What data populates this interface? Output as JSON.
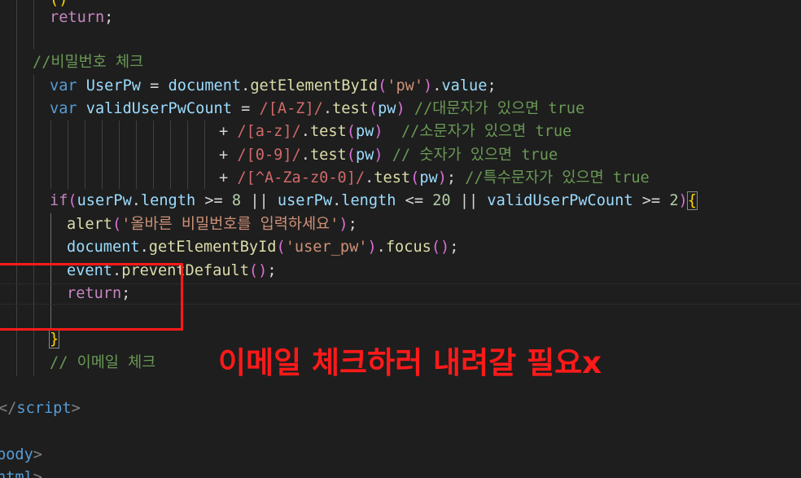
{
  "editor": {
    "language": "html",
    "theme": "dark",
    "colors": {
      "background": "#1e1e1e",
      "keyword": "#569cd6",
      "control": "#c586c0",
      "variable": "#9cdcfe",
      "function": "#dcdcaa",
      "string": "#ce9178",
      "regex": "#d16969",
      "comment": "#6a9955",
      "number": "#b5cea8",
      "annotation": "#ff1a1a"
    }
  },
  "code": {
    "l1": {
      "kw": "return",
      "p": ";"
    },
    "l3": {
      "comment": "//비밀번호 체크"
    },
    "l4": {
      "kw": "var",
      "name": "UserPw",
      "eq": " = ",
      "obj": "document",
      "dot": ".",
      "fn": "getElementById",
      "po": "(",
      "str": "'pw'",
      "pc": ")",
      "dot2": ".",
      "prop": "value",
      "semi": ";"
    },
    "l5": {
      "kw": "var",
      "name": "validUserPwCount",
      "eq": " = ",
      "re": "/[A-Z]/",
      "dot": ".",
      "fn": "test",
      "po": "(",
      "arg": "pw",
      "pc": ")",
      "sp": " ",
      "comment": "//대문자가 있으면 true"
    },
    "l6": {
      "plus": "+ ",
      "re": "/[a-z]/",
      "dot": ".",
      "fn": "test",
      "po": "(",
      "arg": "pw",
      "pc": ")",
      "sp": "  ",
      "comment": "//소문자가 있으면 true"
    },
    "l7": {
      "plus": "+ ",
      "re": "/[0-9]/",
      "dot": ".",
      "fn": "test",
      "po": "(",
      "arg": "pw",
      "pc": ")",
      "sp": " ",
      "comment": "// 숫자가 있으면 true"
    },
    "l8": {
      "plus": "+ ",
      "re": "/[^A-Za-z0-0]/",
      "dot": ".",
      "fn": "test",
      "po": "(",
      "arg": "pw",
      "pc": ")",
      "semi": "; ",
      "comment": "//특수문자가 있으면 true"
    },
    "l9": {
      "kw": "if",
      "po": "(",
      "v1": "userPw",
      "d1": ".",
      "p1": "length",
      "op1": " >= ",
      "n1": "8",
      "or1": " || ",
      "v2": "userPw",
      "d2": ".",
      "p2": "length",
      "op2": " <= ",
      "n2": "20",
      "or2": " || ",
      "v3": "validUserPwCount",
      "op3": " >= ",
      "n3": "2",
      "pc": ")",
      "bo": "{"
    },
    "l10": {
      "fn": "alert",
      "po": "(",
      "str": "'올바른 비밀번호를 입력하세요'",
      "pc": ")",
      "semi": ";"
    },
    "l11": {
      "obj": "document",
      "dot": ".",
      "fn": "getElementById",
      "po": "(",
      "str": "'user_pw'",
      "pc": ")",
      "dot2": ".",
      "fn2": "focus",
      "po2": "()",
      "semi": ";"
    },
    "l12": {
      "obj": "event",
      "dot": ".",
      "fn": "preventDefault",
      "po": "()",
      "semi": ";"
    },
    "l13": {
      "kw": "return",
      "semi": ";"
    },
    "l15": {
      "bc": "}"
    },
    "l16": {
      "comment": "// 이메일 체크"
    },
    "l17": {
      "lt": "</",
      "tag": "script",
      "gt": ">"
    },
    "l19": {
      "tag": "body",
      "gt": ">"
    },
    "l20": {
      "tag": "html",
      "gt": ">"
    }
  },
  "annotation": {
    "text": "이메일 체크하러 내려갈 필요x"
  }
}
